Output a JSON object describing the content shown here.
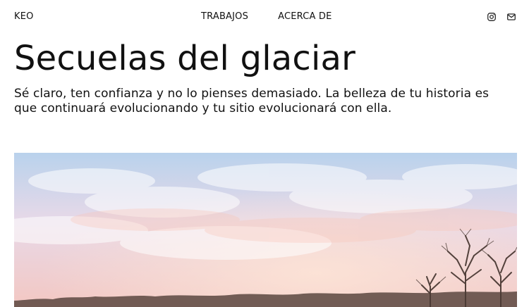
{
  "header": {
    "brand": "KEO",
    "nav": [
      "TRABAJOS",
      "ACERCA DE"
    ],
    "icons": [
      "instagram-icon",
      "mail-icon"
    ]
  },
  "page": {
    "title": "Secuelas del glaciar",
    "lead": "Sé claro, ten confianza y no lo pienses demasiado. La belleza de tu historia es que continuará evolucionando y tu sitio evolucionará con ella."
  },
  "hero": {
    "sky_top": "#b9d2ec",
    "sky_mid": "#e8d9e8",
    "sky_bottom": "#f3c7c2",
    "tree_color": "#4b3a34"
  }
}
